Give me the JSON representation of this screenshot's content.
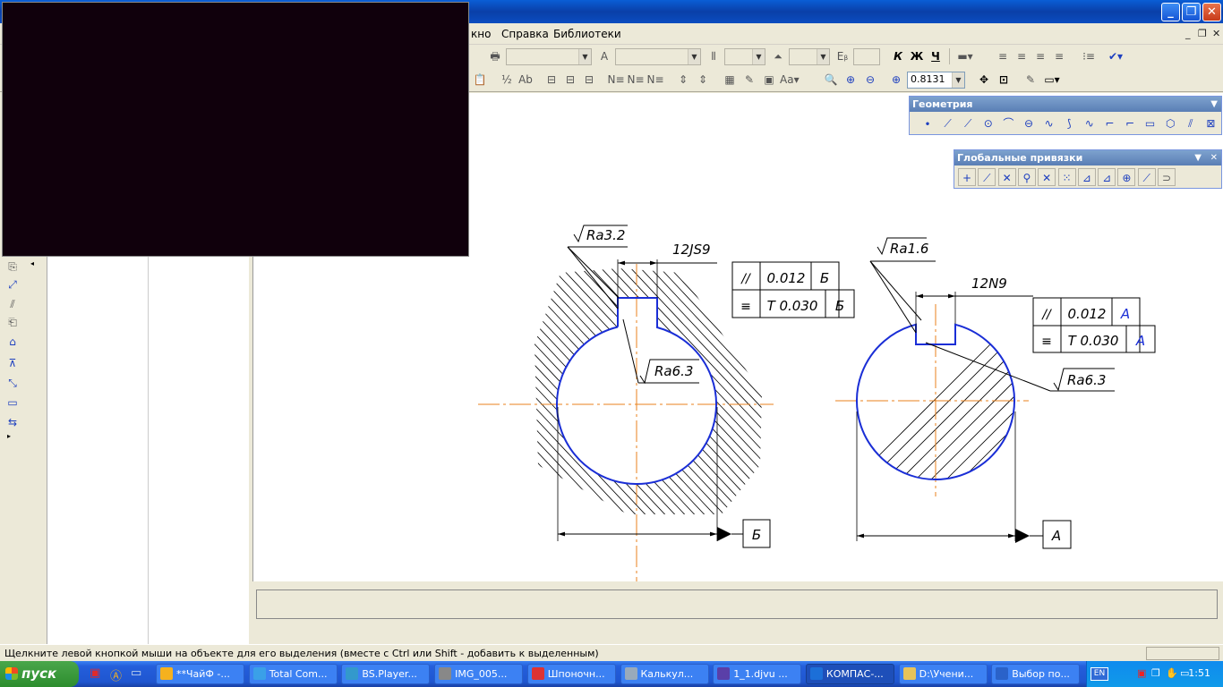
{
  "window": {
    "minimize_icon": "minimize-icon",
    "maximize_icon": "restore-icon",
    "close_icon": "close-icon"
  },
  "menu": {
    "items": [
      "кно",
      "Справка",
      "Библиотеки"
    ]
  },
  "toolbar": {
    "zoom_value": "0.8131",
    "format_bold": "К",
    "format_italic": "Ж",
    "format_underline": "Ч"
  },
  "geometry_panel": {
    "title": "Геометрия"
  },
  "snaps_panel": {
    "title": "Глобальные привязки"
  },
  "drawing": {
    "left_detail": {
      "roughness_top": "Ra3.2",
      "keyway_tolerance": "12JS9",
      "frame_row1": [
        "//",
        "0.012",
        "Б"
      ],
      "frame_row2": [
        "≡",
        "T 0.030",
        "Б"
      ],
      "roughness_keyway": "Ra6.3",
      "datum": "Б"
    },
    "right_detail": {
      "roughness_top": "Ra1.6",
      "keyway_tolerance": "12N9",
      "frame_row1": [
        "//",
        "0.012",
        "A"
      ],
      "frame_row2": [
        "≡",
        "T 0.030",
        "A"
      ],
      "roughness_keyway": "Ra6.3",
      "datum": "A"
    },
    "colors": {
      "contour": "#1a2ed6",
      "axis": "#e8821e",
      "line": "#000000"
    }
  },
  "status": {
    "text": "Щелкните левой кнопкой мыши на объекте для его выделения (вместе с Ctrl или Shift - добавить к выделенным)"
  },
  "taskbar": {
    "start_label": "пуск",
    "tasks": [
      "**ЧайФ -...",
      "Total Com...",
      "BS.Player...",
      "IMG_005...",
      "Шпоночн...",
      "Калькул...",
      "1_1.djvu ...",
      "КОМПАС-...",
      "D:\\Учени...",
      "Выбор по..."
    ],
    "active_task_index": 7,
    "tray_lang": "EN",
    "clock": "1:51"
  }
}
